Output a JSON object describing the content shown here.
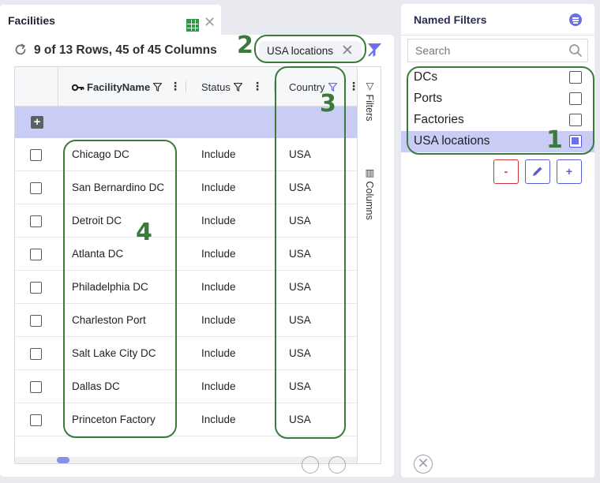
{
  "tab": {
    "title": "Facilities",
    "close_glyph": "✕",
    "icon": "grid-icon"
  },
  "toolbar": {
    "row_summary": "9 of 13 Rows, 45 of 45 Columns",
    "active_filter_chip": "USA locations",
    "chip_close_glyph": "✕"
  },
  "grid": {
    "columns": [
      {
        "label": "FacilityName",
        "key_icon": true,
        "filtered": false
      },
      {
        "label": "Status",
        "filtered": false
      },
      {
        "label": "Country",
        "filtered": true
      }
    ],
    "add_glyph": "+",
    "rows": [
      {
        "name": "Chicago DC",
        "status": "Include",
        "country": "USA"
      },
      {
        "name": "San Bernardino DC",
        "status": "Include",
        "country": "USA"
      },
      {
        "name": "Detroit DC",
        "status": "Include",
        "country": "USA"
      },
      {
        "name": "Atlanta DC",
        "status": "Include",
        "country": "USA"
      },
      {
        "name": "Philadelphia DC",
        "status": "Include",
        "country": "USA"
      },
      {
        "name": "Charleston Port",
        "status": "Include",
        "country": "USA"
      },
      {
        "name": "Salt Lake City DC",
        "status": "Include",
        "country": "USA"
      },
      {
        "name": "Dallas DC",
        "status": "Include",
        "country": "USA"
      },
      {
        "name": "Princeton Factory",
        "status": "Include",
        "country": "USA"
      }
    ],
    "side_tabs": {
      "filters": "Filters",
      "columns": "Columns"
    }
  },
  "named_filters": {
    "title": "Named Filters",
    "search_placeholder": "Search",
    "items": [
      {
        "label": "DCs",
        "checked": false
      },
      {
        "label": "Ports",
        "checked": false
      },
      {
        "label": "Factories",
        "checked": false
      },
      {
        "label": "USA locations",
        "checked": true
      }
    ],
    "remove_label": "-",
    "add_label": "+",
    "close_glyph": "✕"
  },
  "annotations": {
    "n1": "1",
    "n2": "2",
    "n3": "3",
    "n4": "4"
  },
  "colors": {
    "accent": "#6b6fe8",
    "selection": "#c9cdf6",
    "annotation": "#3c7a3b",
    "remove": "#c9373a"
  }
}
